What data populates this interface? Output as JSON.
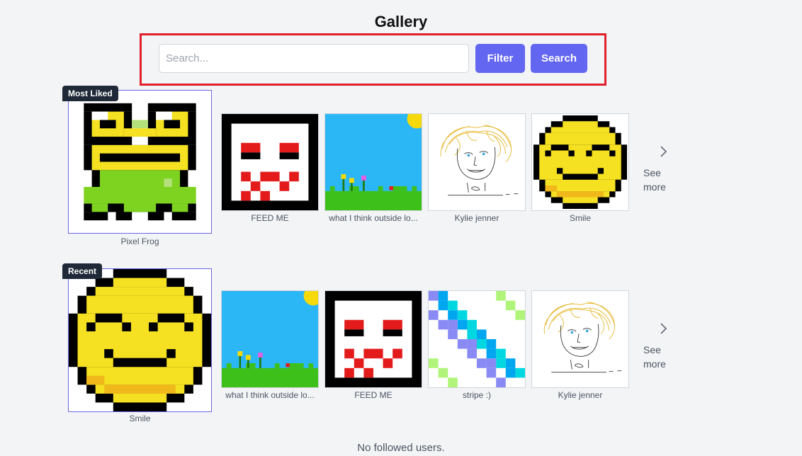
{
  "page": {
    "title": "Gallery"
  },
  "search": {
    "placeholder": "Search...",
    "filter_label": "Filter",
    "search_label": "Search"
  },
  "sections": [
    {
      "badge": "Most Liked",
      "featured": {
        "caption": "Pixel Frog",
        "icon": "frog-pixel-art"
      },
      "items": [
        {
          "caption": "FEED ME",
          "icon": "mask-pixel-art"
        },
        {
          "caption": "what I think outside lo...",
          "icon": "landscape-pixel-art"
        },
        {
          "caption": "Kylie jenner",
          "icon": "face-sketch"
        },
        {
          "caption": "Smile",
          "icon": "smiley-pixel-art"
        }
      ],
      "see_more": [
        "See",
        "more"
      ]
    },
    {
      "badge": "Recent",
      "featured": {
        "caption": "Smile",
        "icon": "smiley-pixel-art"
      },
      "items": [
        {
          "caption": "what I think outside lo...",
          "icon": "landscape-pixel-art"
        },
        {
          "caption": "FEED ME",
          "icon": "mask-pixel-art"
        },
        {
          "caption": "stripe :)",
          "icon": "stripe-pixel-art"
        },
        {
          "caption": "Kylie jenner",
          "icon": "face-sketch"
        }
      ],
      "see_more": [
        "See",
        "more"
      ]
    }
  ],
  "footer": {
    "text": "No followed users."
  },
  "colors": {
    "accent": "#6366f1",
    "highlight_border": "#e0202b",
    "badge": "#1f2937"
  }
}
